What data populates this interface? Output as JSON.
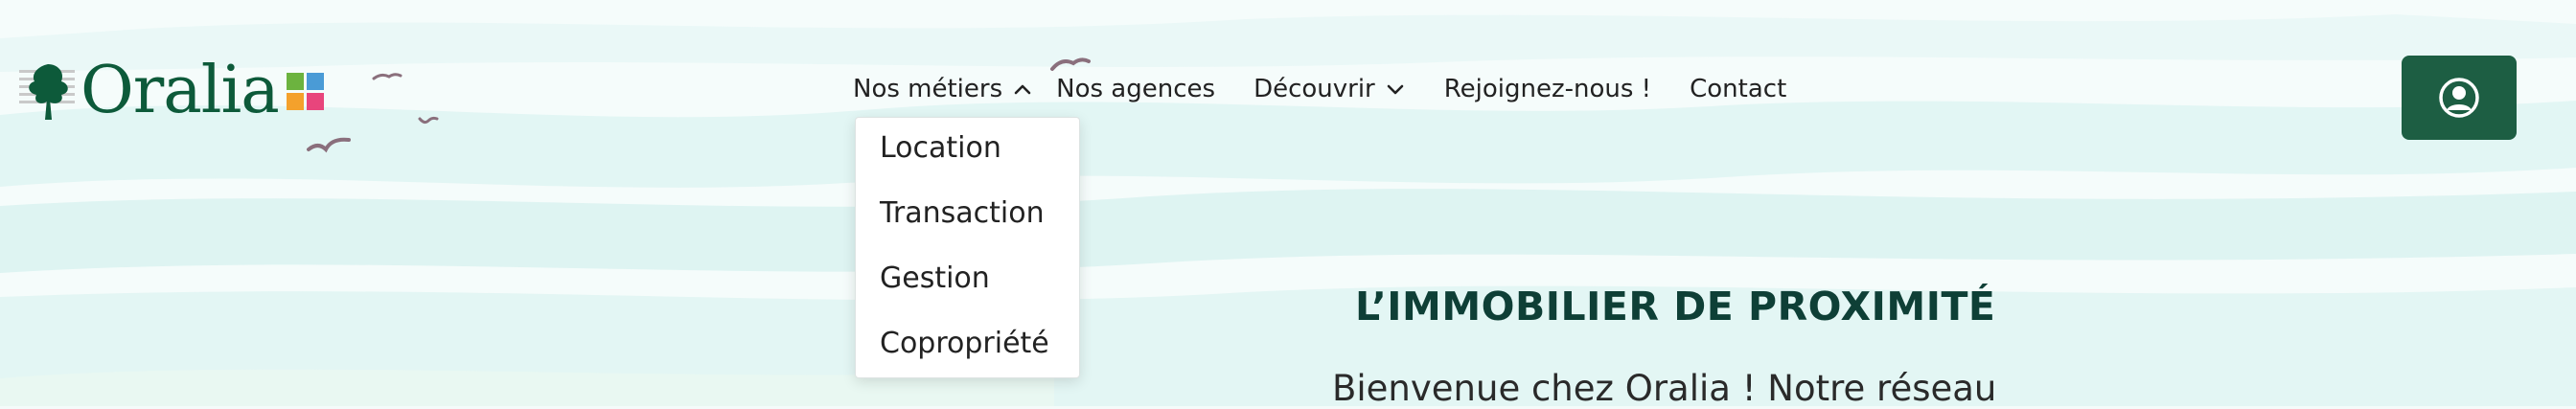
{
  "brand": {
    "name": "Oralia",
    "colors": {
      "green": "#0d5a3a",
      "square_green": "#6cb33f",
      "square_blue": "#4a9bd6",
      "square_orange": "#f4a12c",
      "square_pink": "#e8457c"
    }
  },
  "nav": {
    "items": [
      {
        "label": "Nos métiers",
        "has_menu": true,
        "open": true
      },
      {
        "label": "Nos agences",
        "has_menu": false
      },
      {
        "label": "Découvrir",
        "has_menu": true,
        "open": false
      },
      {
        "label": "Rejoignez-nous !",
        "has_menu": false
      },
      {
        "label": "Contact",
        "has_menu": false
      }
    ]
  },
  "dropdown": {
    "items": [
      "Location",
      "Transaction",
      "Gestion",
      "Copropriété"
    ]
  },
  "account": {
    "icon": "user-circle-icon",
    "color": "#1d5e43"
  },
  "hero": {
    "title": "L’IMMOBILIER DE PROXIMITÉ",
    "text": "Bienvenue chez Oralia ! Notre réseau"
  }
}
